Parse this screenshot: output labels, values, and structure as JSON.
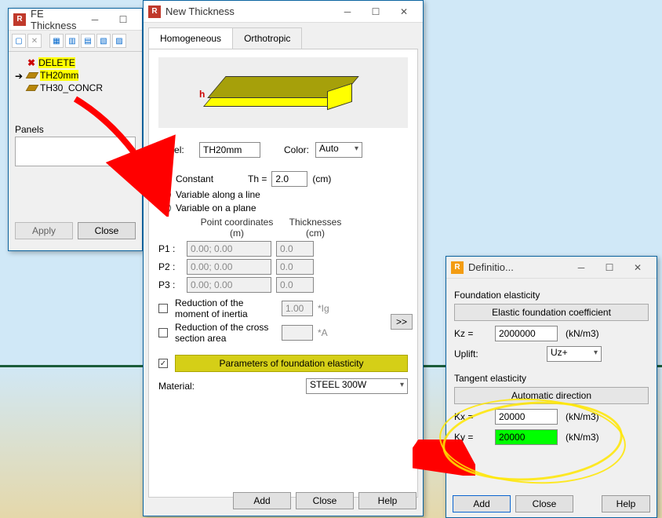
{
  "fe": {
    "title": "FE Thickness",
    "items": {
      "delete": "DELETE",
      "th20": "TH20mm",
      "th30": "TH30_CONCR"
    },
    "panels_label": "Panels",
    "apply": "Apply",
    "close": "Close"
  },
  "nt": {
    "title": "New Thickness",
    "tab_homog": "Homogeneous",
    "tab_ortho": "Orthotropic",
    "h_label": "h",
    "label_lbl": "Label:",
    "label_val": "TH20mm",
    "color_lbl": "Color:",
    "color_val": "Auto",
    "r_constant": "Constant",
    "r_var_line": "Variable along a line",
    "r_var_plane": "Variable on a plane",
    "th_lbl": "Th =",
    "th_val": "2.0",
    "th_unit": "(cm)",
    "hdr_coords": "Point coordinates\n(m)",
    "hdr_thick": "Thicknesses\n(cm)",
    "p1": "P1 :",
    "p2": "P2 :",
    "p3": "P3 :",
    "coord_ph": "0.00; 0.00",
    "thk_ph": "0.0",
    "red_moi": "Reduction of the moment of inertia",
    "red_moi_val": "1.00",
    "red_moi_unit": "*Ig",
    "red_csa": "Reduction of the cross section area",
    "red_csa_unit": "*A",
    "arrow_btn": ">>",
    "params_btn": "Parameters of foundation elasticity",
    "material_lbl": "Material:",
    "material_val": "STEEL 300W",
    "add": "Add",
    "close": "Close",
    "help": "Help"
  },
  "def": {
    "title": "Definitio...",
    "sec_found": "Foundation elasticity",
    "efc_btn": "Elastic foundation coefficient",
    "kz_lbl": "Kz =",
    "kz_val": "2000000",
    "unit": "(kN/m3)",
    "uplift_lbl": "Uplift:",
    "uplift_val": "Uz+",
    "sec_tan": "Tangent elasticity",
    "auto_btn": "Automatic direction",
    "kx_lbl": "Kx =",
    "kx_val": "20000",
    "ky_lbl": "Ky =",
    "ky_val": "20000",
    "add": "Add",
    "close": "Close",
    "help": "Help"
  }
}
